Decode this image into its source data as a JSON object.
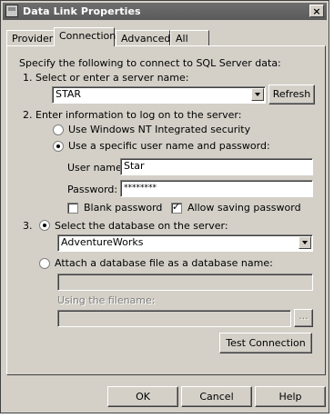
{
  "window": {
    "title": "Data Link Properties",
    "close_glyph": "×"
  },
  "tabs": [
    {
      "label": "Provider"
    },
    {
      "label": "Connection"
    },
    {
      "label": "Advanced"
    },
    {
      "label": "All"
    }
  ],
  "intro": "Specify the following to connect to SQL Server data:",
  "step1": {
    "label": "1. Select or enter a server name:",
    "server_value": "STAR",
    "refresh": "Refresh"
  },
  "step2": {
    "label": "2. Enter information to log on to the server:",
    "option_nt": "Use Windows NT Integrated security",
    "option_specific": "Use a specific user name and password:",
    "username_label": "User name:",
    "username_value": "Star",
    "password_label": "Password:",
    "password_value": "********",
    "blank_password": "Blank password",
    "allow_saving": "Allow saving password"
  },
  "step3": {
    "number": "3.",
    "option_select_db": "Select the database on the server:",
    "db_value": "AdventureWorks",
    "option_attach": "Attach a database file as a database name:",
    "attach_value": "",
    "filename_label": "Using the filename:",
    "filename_value": "",
    "browse": "..."
  },
  "test_button": "Test Connection",
  "footer": {
    "ok": "OK",
    "cancel": "Cancel",
    "help": "Help"
  }
}
